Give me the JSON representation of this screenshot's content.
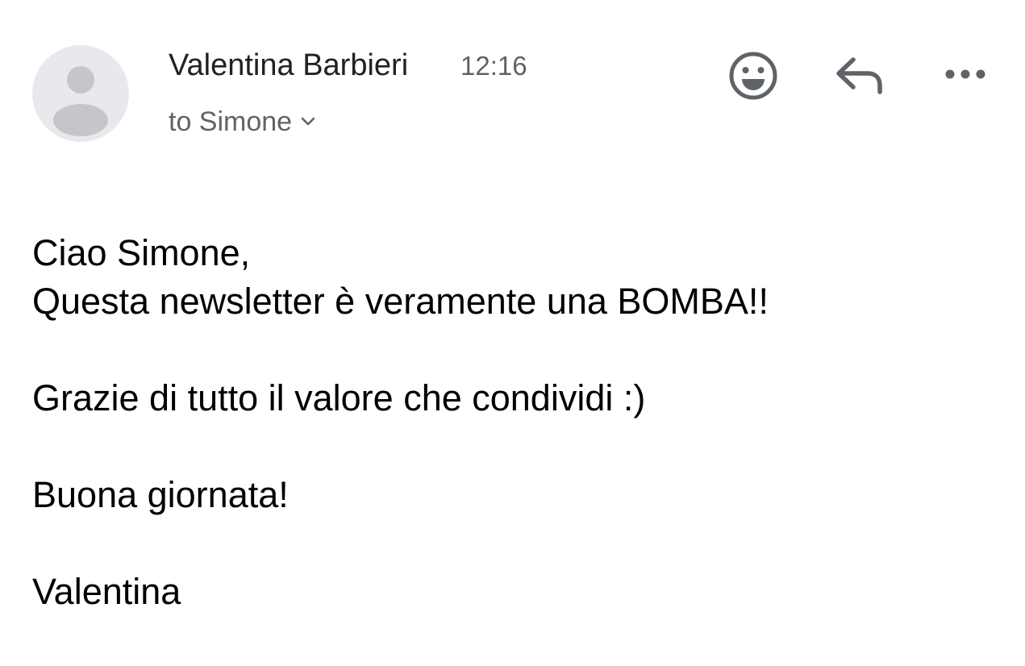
{
  "message": {
    "sender_name": "Valentina Barbieri",
    "time": "12:16",
    "recipient_label": "to Simone",
    "body_lines": {
      "greeting": "Ciao Simone,",
      "line1": "Questa newsletter è veramente una BOMBA!!",
      "line2": "Grazie di tutto il valore che condividi :)",
      "line3": "Buona giornata!",
      "signature": "Valentina"
    }
  },
  "icons": {
    "avatar": "person-placeholder-icon",
    "emoji": "smiley-face-icon",
    "reply": "reply-arrow-icon",
    "more": "more-horizontal-icon",
    "recipient_expand": "chevron-down-icon"
  },
  "colors": {
    "avatar_bg": "#e8e9ec",
    "avatar_figure": "#c4c6ca",
    "secondary_text": "#5f6368",
    "icon": "#5f6368"
  }
}
